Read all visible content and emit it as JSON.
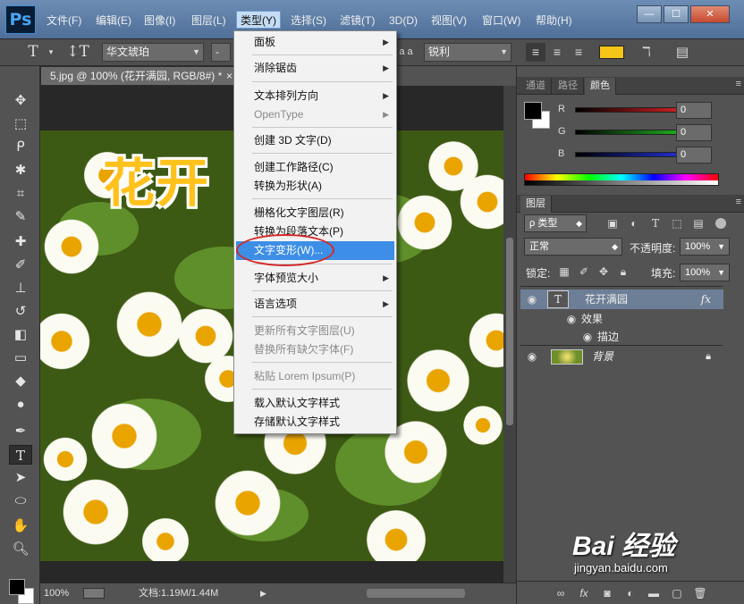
{
  "menubar": {
    "logo": "Ps",
    "items": [
      "文件(F)",
      "编辑(E)",
      "图像(I)",
      "图层(L)",
      "类型(Y)",
      "选择(S)",
      "滤镜(T)",
      "3D(D)",
      "视图(V)",
      "窗口(W)",
      "帮助(H)"
    ],
    "active_index": 4,
    "window_buttons": [
      "—",
      "☐",
      "✕"
    ]
  },
  "options": {
    "font_family": "华文琥珀",
    "font_style": "-",
    "aa_label": "a a",
    "antialias": "锐利",
    "color_swatch": "#f5c518"
  },
  "document": {
    "tab_title": "5.jpg @ 100% (花开满园, RGB/8#) *",
    "tab_close": "×",
    "canvas_text": "花开",
    "zoom": "100%",
    "doc_size": "文档:1.19M/1.44M",
    "status_arrow": "▶"
  },
  "type_menu": {
    "items": [
      {
        "label": "面板",
        "sub": true,
        "disabled": false
      },
      {
        "label": "消除锯齿",
        "sub": true,
        "disabled": false
      },
      {
        "label": "文本排列方向",
        "sub": true,
        "disabled": false
      },
      {
        "label": "OpenType",
        "sub": true,
        "disabled": true
      },
      {
        "label": "创建 3D 文字(D)",
        "sub": false,
        "disabled": false
      },
      {
        "label": "创建工作路径(C)",
        "sub": false,
        "disabled": false
      },
      {
        "label": "转换为形状(A)",
        "sub": false,
        "disabled": false
      },
      {
        "label": "栅格化文字图层(R)",
        "sub": false,
        "disabled": false
      },
      {
        "label": "转换为段落文本(P)",
        "sub": false,
        "disabled": false
      },
      {
        "label": "文字变形(W)...",
        "sub": false,
        "disabled": false,
        "highlighted": true
      },
      {
        "label": "字体预览大小",
        "sub": true,
        "disabled": false
      },
      {
        "label": "语言选项",
        "sub": true,
        "disabled": false
      },
      {
        "label": "更新所有文字图层(U)",
        "sub": false,
        "disabled": true
      },
      {
        "label": "替换所有缺欠字体(F)",
        "sub": false,
        "disabled": true
      },
      {
        "label": "粘贴 Lorem Ipsum(P)",
        "sub": false,
        "disabled": true
      },
      {
        "label": "载入默认文字样式",
        "sub": false,
        "disabled": false
      },
      {
        "label": "存储默认文字样式",
        "sub": false,
        "disabled": false
      }
    ]
  },
  "color_panel": {
    "tabs": [
      "通道",
      "路径",
      "颜色"
    ],
    "active_tab": 2,
    "channels": [
      {
        "label": "R",
        "value": "0",
        "color": "#d01f1f"
      },
      {
        "label": "G",
        "value": "0",
        "color": "#1fae1f"
      },
      {
        "label": "B",
        "value": "0",
        "color": "#1f2fd0"
      }
    ]
  },
  "layers_panel": {
    "tab": "图层",
    "filter_kind": "ρ 类型",
    "blend_mode": "正常",
    "opacity_label": "不透明度:",
    "opacity": "100%",
    "lock_label": "锁定:",
    "fill_label": "填充:",
    "fill": "100%",
    "layers": [
      {
        "name": "花开满园",
        "thumb": "T",
        "fx": "fx"
      },
      {
        "name": "效果"
      },
      {
        "name": "描边"
      },
      {
        "name": "背景"
      }
    ]
  },
  "watermark": {
    "main": "Bai 经验",
    "url": "jingyan.baidu.com"
  }
}
